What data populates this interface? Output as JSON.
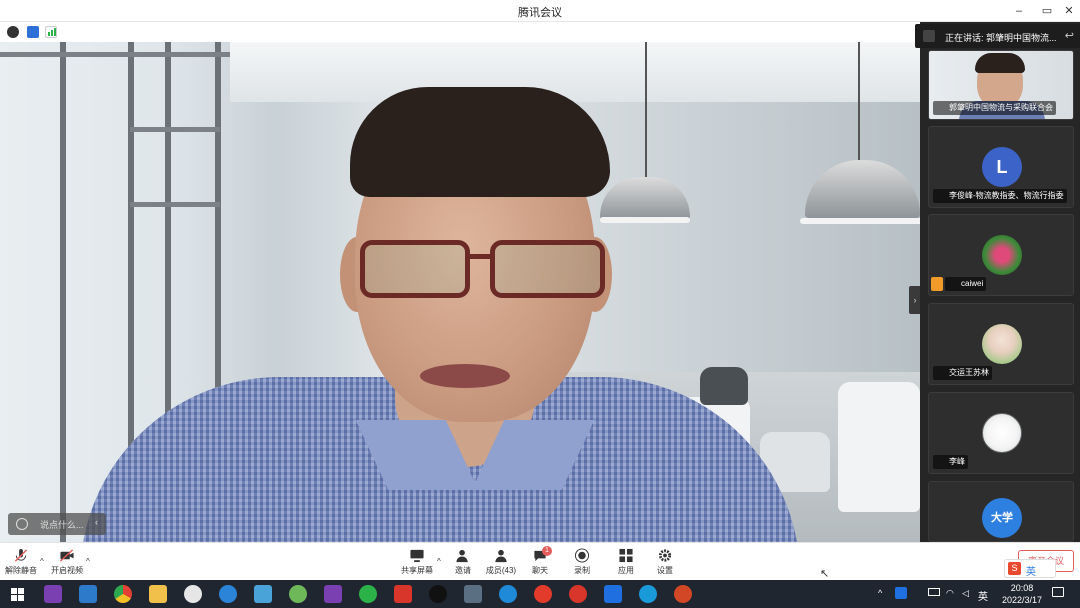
{
  "window": {
    "title": "腾讯会议",
    "controls": {
      "minimize": "–",
      "maximize": "▭",
      "close": "✕"
    }
  },
  "status_icons": [
    "info-icon",
    "shield-icon",
    "signal-icon"
  ],
  "main_video": {
    "chat_placeholder": "说点什么..."
  },
  "speaker_banner": {
    "label": "正在讲话: 郭肇明中国物流..."
  },
  "participants": [
    {
      "name": "郭肇明中国物流与采购联合会",
      "type": "video"
    },
    {
      "name": "李俊峰-物流教指委、物流行指委",
      "type": "letter",
      "letter": "L"
    },
    {
      "name": "caiwei",
      "type": "flower"
    },
    {
      "name": "交运王苏林",
      "type": "portrait"
    },
    {
      "name": "李峰",
      "type": "cartoon"
    },
    {
      "name": "",
      "type": "text-avatar",
      "letter": "大学"
    }
  ],
  "toolbar": {
    "unmute": "解除静音",
    "start_video": "开启视频",
    "share_screen": "共享屏幕",
    "invite": "邀请",
    "members": "成员(43)",
    "chat": "聊天",
    "chat_badge": "1",
    "record": "录制",
    "apps": "应用",
    "settings": "设置",
    "leave": "离开会议"
  },
  "ime": {
    "label": "英"
  },
  "taskbar": {
    "lang": "英",
    "time": "20:08",
    "date": "2022/3/17"
  },
  "colors": {
    "accent_blue": "#3c64c8",
    "danger_red": "#e35b5b",
    "taskbar_bg": "#1f2630"
  }
}
